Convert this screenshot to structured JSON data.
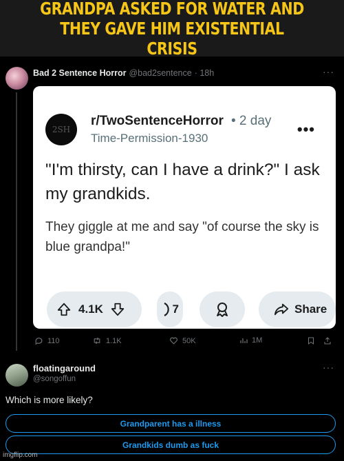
{
  "caption": "GRANDPA ASKED FOR WATER AND THEY GAVE HIM EXISTENTIAL CRISIS",
  "tweet": {
    "author_name": "Bad 2 Sentence Horror",
    "author_handle": "@bad2sentence",
    "time": "· 18h",
    "more": "···",
    "card": {
      "subreddit": "r/TwoSentenceHorror",
      "post_time": "• 2 day",
      "username": "Time-Permission-1930",
      "avatar_text": "2SH",
      "more": "•••",
      "title": "\"I'm thirsty, can I have a drink?\" I ask my grandkids.",
      "body": "They giggle at me and say \"of course the sky is blue grandpa!\"",
      "votes": "4.1K",
      "comments": "7",
      "share_label": "Share"
    },
    "actions": {
      "replies": "110",
      "retweets": "1.1K",
      "likes": "50K",
      "views": "1M"
    }
  },
  "reply": {
    "author_name": "floatingaround",
    "author_handle": "@songoffun",
    "more": "···",
    "text": "Which is more likely?",
    "poll_options": [
      "Grandparent has a illness",
      "Grandkids dumb as fuck"
    ]
  },
  "watermark": "imgflip.com",
  "colors": {
    "caption_text": "#f5c518",
    "accent": "#1d9bf0"
  }
}
